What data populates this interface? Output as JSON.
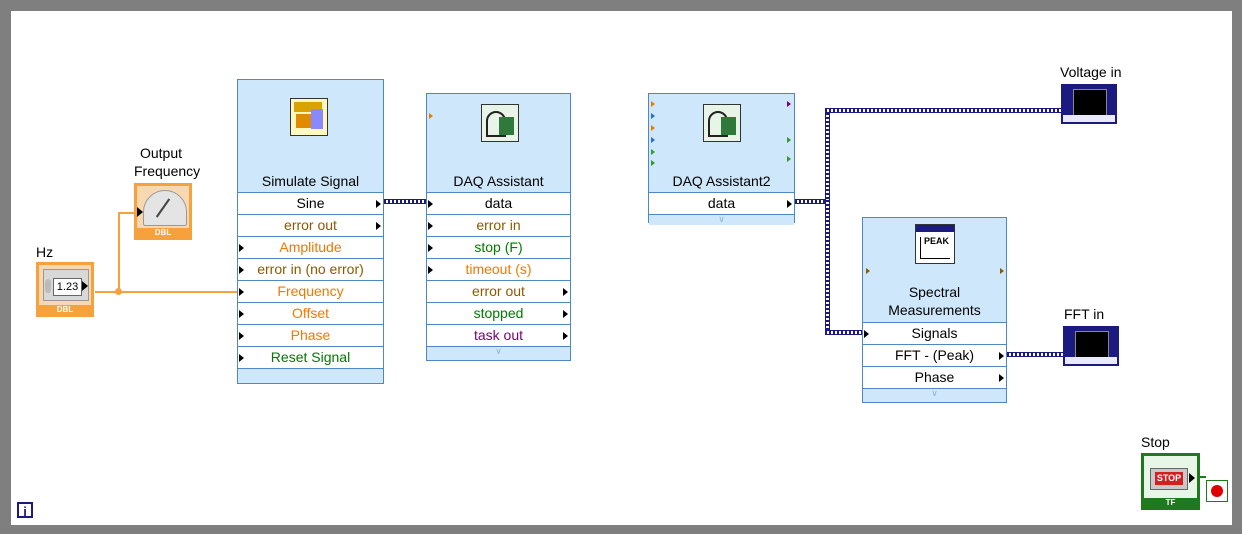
{
  "controls": {
    "hz_label": "Hz",
    "hz_value": "1.23",
    "hz_type": "DBL",
    "output_frequency_label_1": "Output",
    "output_frequency_label_2": "Frequency",
    "output_frequency_type": "DBL",
    "voltage_in_label": "Voltage in",
    "fft_in_label": "FFT in",
    "stop_label": "Stop",
    "stop_button_text": "STOP",
    "stop_type": "TF",
    "info_icon": "i"
  },
  "simulate_signal": {
    "title": "Simulate Signal",
    "rows": [
      {
        "label": "Sine",
        "color": "#000000"
      },
      {
        "label": "error out",
        "color": "#8a5a00"
      },
      {
        "label": "Amplitude",
        "color": "#f07800"
      },
      {
        "label": "error in (no error)",
        "color": "#8a5a00"
      },
      {
        "label": "Frequency",
        "color": "#f07800"
      },
      {
        "label": "Offset",
        "color": "#f07800"
      },
      {
        "label": "Phase",
        "color": "#f07800"
      },
      {
        "label": "Reset Signal",
        "color": "#007a00"
      }
    ]
  },
  "daq_assistant": {
    "title": "DAQ Assistant",
    "rows": [
      {
        "label": "data",
        "color": "#000000"
      },
      {
        "label": "error in",
        "color": "#8a5a00"
      },
      {
        "label": "stop (F)",
        "color": "#007a00"
      },
      {
        "label": "timeout (s)",
        "color": "#f07800"
      },
      {
        "label": "error out",
        "color": "#8a5a00"
      },
      {
        "label": "stopped",
        "color": "#007a00"
      },
      {
        "label": "task out",
        "color": "#7a0080"
      }
    ]
  },
  "daq_assistant2": {
    "title": "DAQ Assistant2",
    "rows": [
      {
        "label": "data",
        "color": "#000000"
      }
    ]
  },
  "spectral": {
    "title_1": "Spectral",
    "title_2": "Measurements",
    "icon_text": "PEAK",
    "rows": [
      {
        "label": "Signals",
        "color": "#000000"
      },
      {
        "label": "FFT - (Peak)",
        "color": "#000000"
      },
      {
        "label": "Phase",
        "color": "#000000"
      }
    ]
  }
}
